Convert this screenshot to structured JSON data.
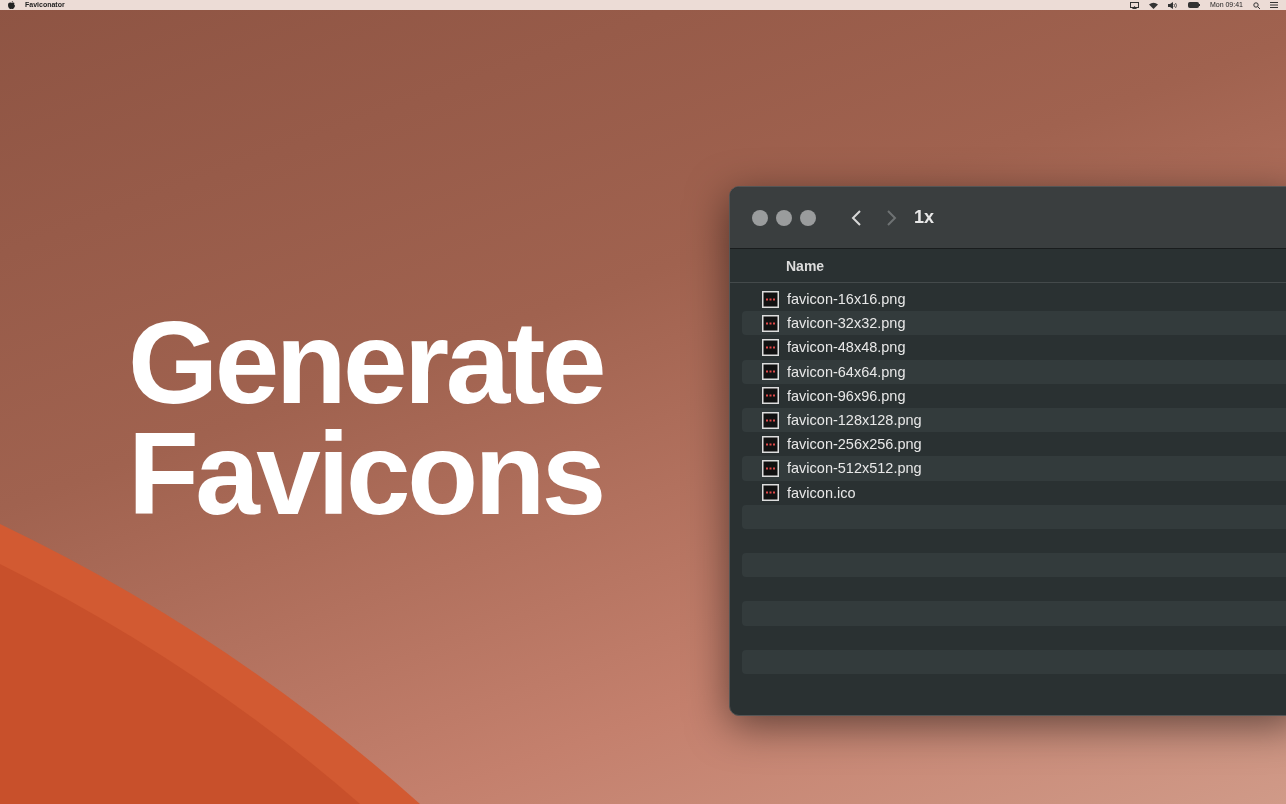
{
  "menu_bar": {
    "app_name": "Faviconator",
    "clock": "Mon 09:41"
  },
  "headline": [
    "Generate",
    "Favicons"
  ],
  "finder": {
    "title": "1x",
    "nav": [
      {
        "kind": "back",
        "disabled": false
      },
      {
        "kind": "forward",
        "disabled": true
      }
    ],
    "column": "Name",
    "files": [
      {
        "name": "favicon-16x16.png"
      },
      {
        "name": "favicon-32x32.png"
      },
      {
        "name": "favicon-48x48.png"
      },
      {
        "name": "favicon-64x64.png"
      },
      {
        "name": "favicon-96x96.png"
      },
      {
        "name": "favicon-128x128.png"
      },
      {
        "name": "favicon-256x256.png"
      },
      {
        "name": "favicon-512x512.png"
      },
      {
        "name": "favicon.ico"
      }
    ]
  }
}
